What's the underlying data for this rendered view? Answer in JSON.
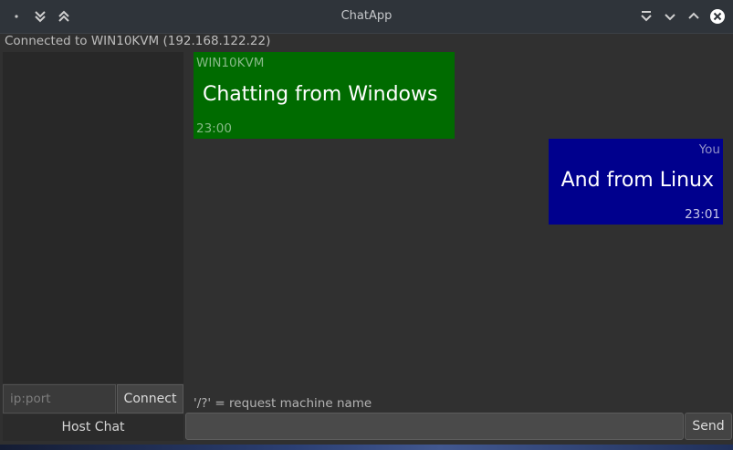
{
  "window": {
    "title": "ChatApp",
    "status": "Connected to WIN10KVM (192.168.122.22)"
  },
  "titlebar_icons": {
    "left": [
      "menu-dot-icon",
      "keep-below-icon",
      "keep-above-icon"
    ],
    "right": [
      "shade-icon",
      "minimize-icon",
      "maximize-icon",
      "close-icon"
    ]
  },
  "sidebar": {
    "ip_placeholder": "ip:port",
    "connect_label": "Connect",
    "host_label": "Host Chat"
  },
  "messages": [
    {
      "sender": "WIN10KVM",
      "text": "Chatting from Windows",
      "time": "23:00",
      "direction": "incoming",
      "color": "#006b00"
    },
    {
      "sender": "You",
      "text": "And from Linux",
      "time": "23:01",
      "direction": "outgoing",
      "color": "#00008d"
    }
  ],
  "composer": {
    "hint": "'/?' = request machine name",
    "input_value": "",
    "send_label": "Send"
  },
  "colors": {
    "background": "#303030",
    "sidebar": "#282828",
    "close_button": "#ffffff"
  }
}
